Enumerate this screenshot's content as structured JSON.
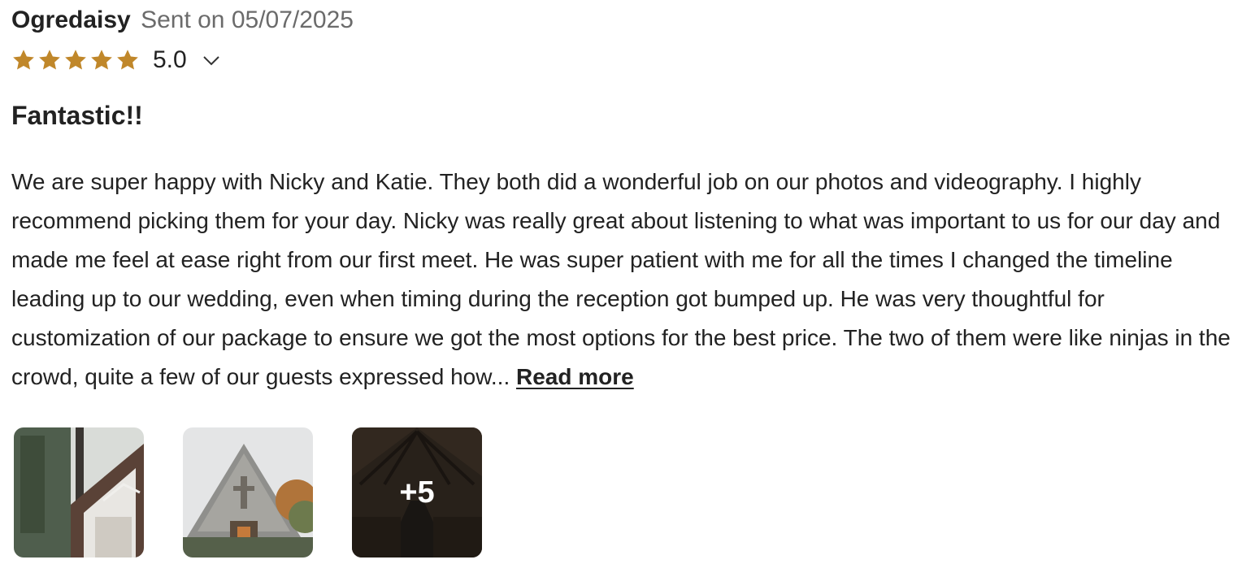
{
  "review": {
    "author": "Ogredaisy",
    "sent_label": "Sent on 05/07/2025",
    "rating_stars": 5,
    "rating_value": "5.0",
    "title": "Fantastic!!",
    "body": "We are super happy with Nicky and Katie. They both did a wonderful job on our photos and videography. I highly recommend picking them for your day. Nicky was really great about listening to what was important to us for our day and made me feel at ease right from our first meet. He was super patient with me for all the times I changed the timeline leading up to our wedding, even when timing during the reception got bumped up. He was very thoughtful for customization of our package to ensure we got the most options for the best price. The two of them were like ninjas in the crowd, quite a few of our guests expressed how...",
    "read_more_label": "Read more",
    "more_photos_label": "+5"
  },
  "colors": {
    "star": "#c0872a",
    "text": "#222222",
    "muted": "#6b6b6b"
  },
  "icons": {
    "star": "star-icon",
    "expand": "chevron-down-icon"
  }
}
